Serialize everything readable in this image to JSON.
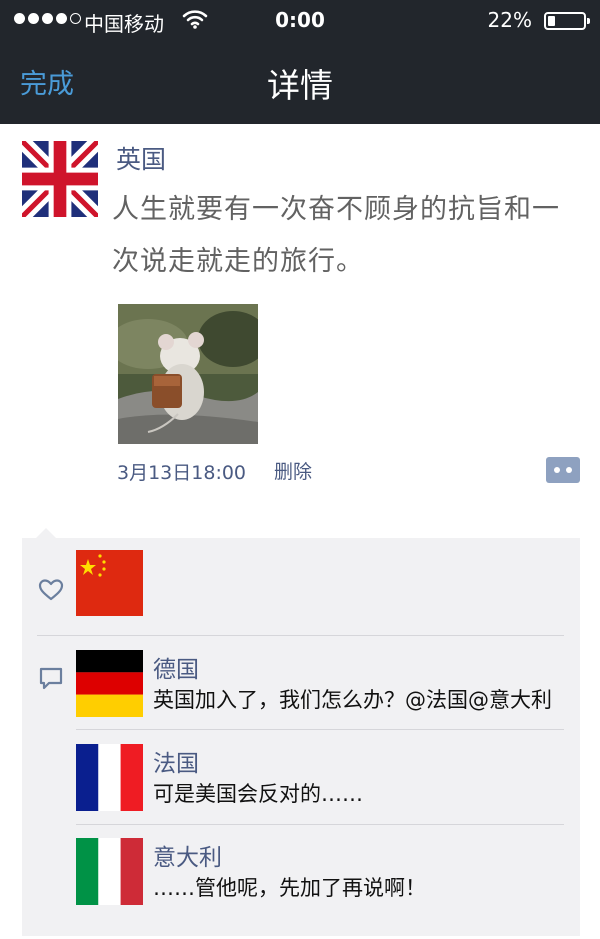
{
  "status_bar": {
    "carrier": "中国移动",
    "time": "0:00",
    "battery": "22%",
    "battery_level": 0.22
  },
  "nav": {
    "done_label": "完成",
    "title": "详情"
  },
  "post": {
    "author": "英国",
    "content": "人生就要有一次奋不顾身的抗旨和一次说走就走的旅行。",
    "time": "3月13日18:00",
    "delete_label": "删除"
  },
  "comments": [
    {
      "name": "德国",
      "text": "英国加入了，我们怎么办？@法国@意大利"
    },
    {
      "name": "法国",
      "text": "可是美国会反对的……"
    },
    {
      "name": "意大利",
      "text": "……管他呢，先加了再说啊！"
    }
  ],
  "colors": {
    "nav_bg": "#22262c",
    "accent": "#4a9bd8",
    "name_blue": "#4a5a82",
    "feedback_bg": "#f1f1f3"
  },
  "icons": [
    "signal-dots-icon",
    "wifi-icon",
    "battery-icon",
    "uk-flag-icon",
    "comment-button-icon",
    "heart-icon",
    "china-flag-icon",
    "speech-bubble-icon",
    "germany-flag-icon",
    "france-flag-icon",
    "italy-flag-icon"
  ]
}
